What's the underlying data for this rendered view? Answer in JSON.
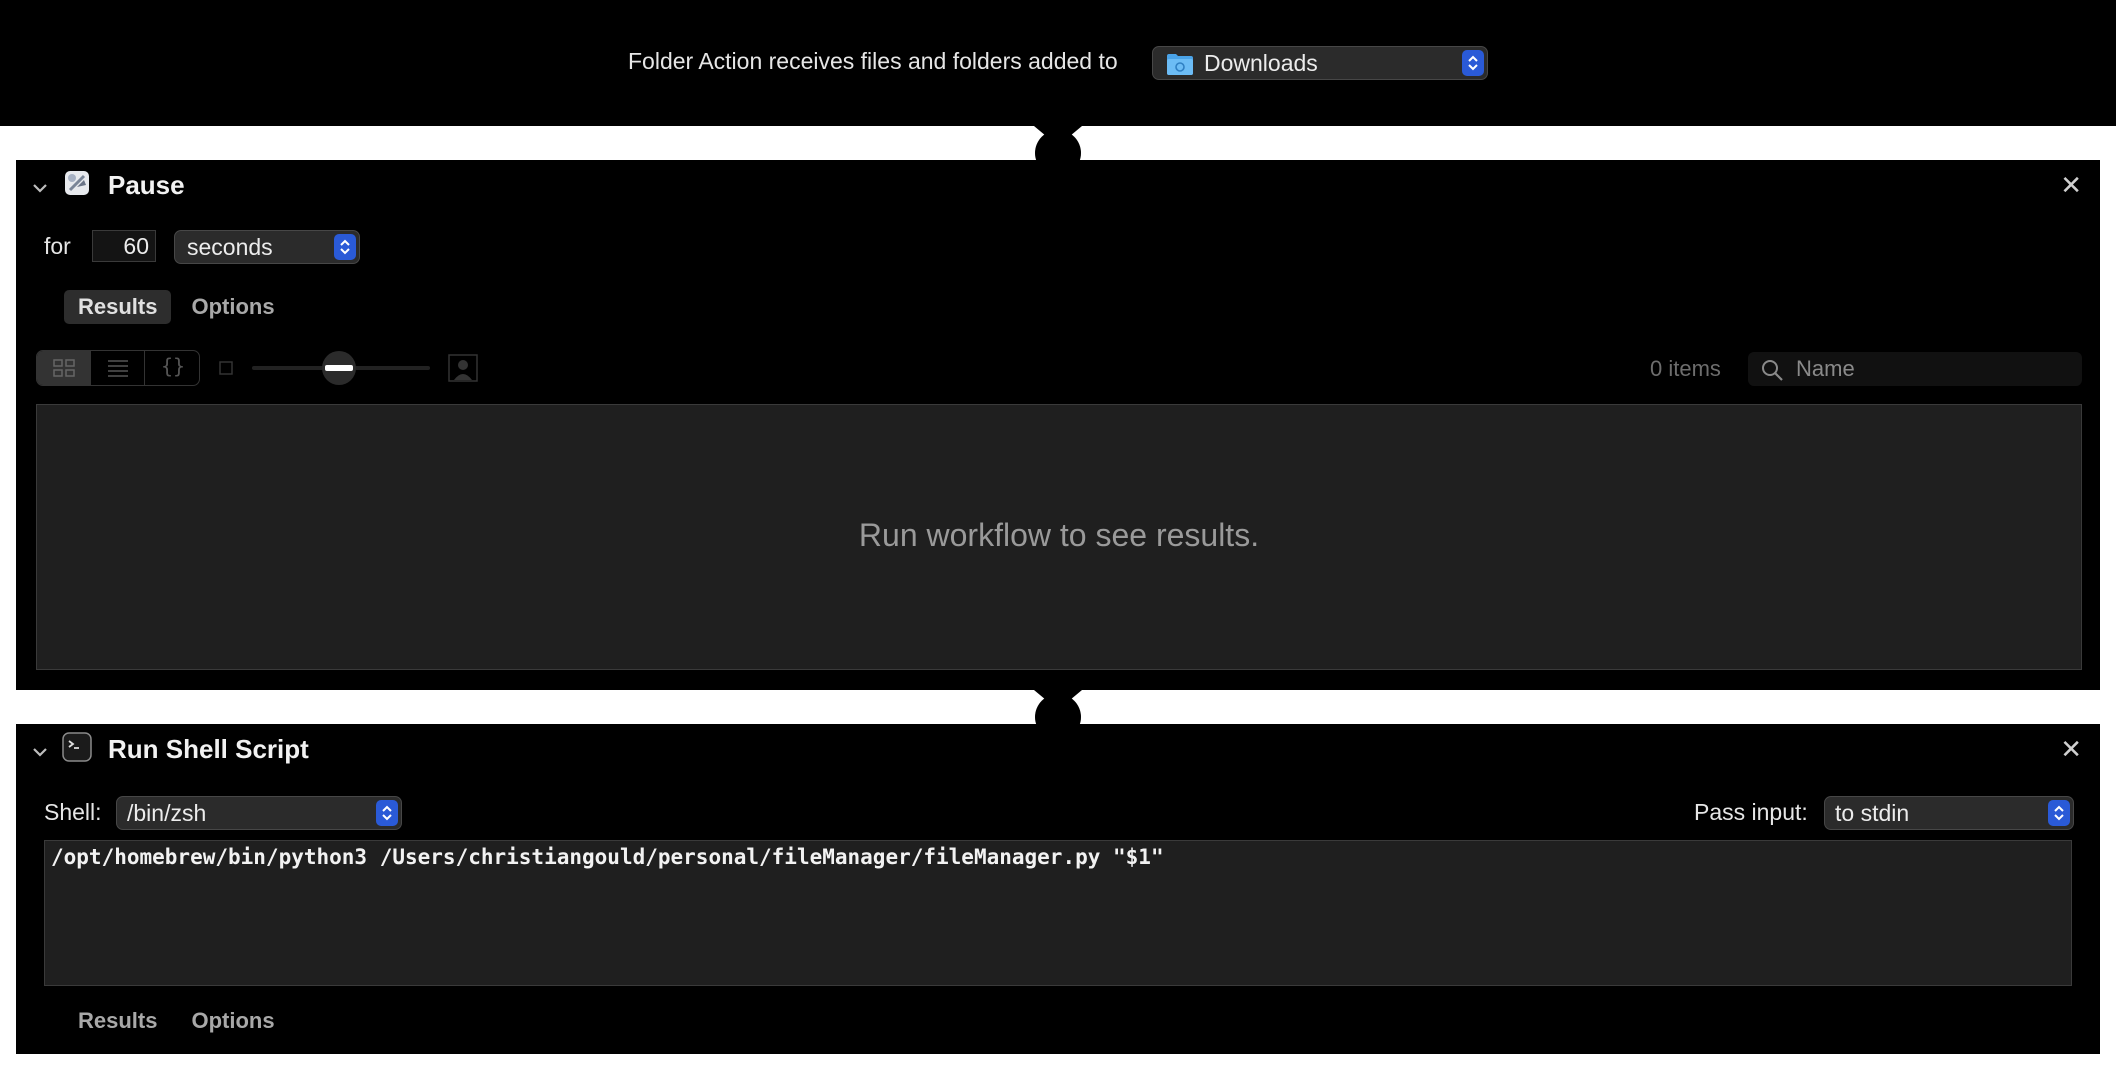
{
  "header": {
    "label": "Folder Action receives files and folders added to",
    "folder_value": "Downloads"
  },
  "pause": {
    "title": "Pause",
    "for_label": "for",
    "duration": "60",
    "unit": "seconds",
    "tabs": [
      {
        "label": "Results",
        "active": true
      },
      {
        "label": "Options",
        "active": false
      }
    ],
    "view_icons": [
      "icon-view-icon",
      "list-view-icon",
      "json-view-icon"
    ],
    "items_count": "0 items",
    "search_placeholder": "Name",
    "results_message": "Run workflow to see results."
  },
  "shell": {
    "title": "Run Shell Script",
    "shell_label": "Shell:",
    "shell_value": "/bin/zsh",
    "pass_label": "Pass input:",
    "pass_value": "to stdin",
    "script": "/opt/homebrew/bin/python3 /Users/christiangould/personal/fileManager/fileManager.py \"$1\"",
    "tabs": [
      {
        "label": "Results",
        "active": false
      },
      {
        "label": "Options",
        "active": false
      }
    ]
  },
  "colors": {
    "accent": "#2a5ad7",
    "panel_bg": "#000000",
    "field_bg": "#1f1f1f"
  }
}
